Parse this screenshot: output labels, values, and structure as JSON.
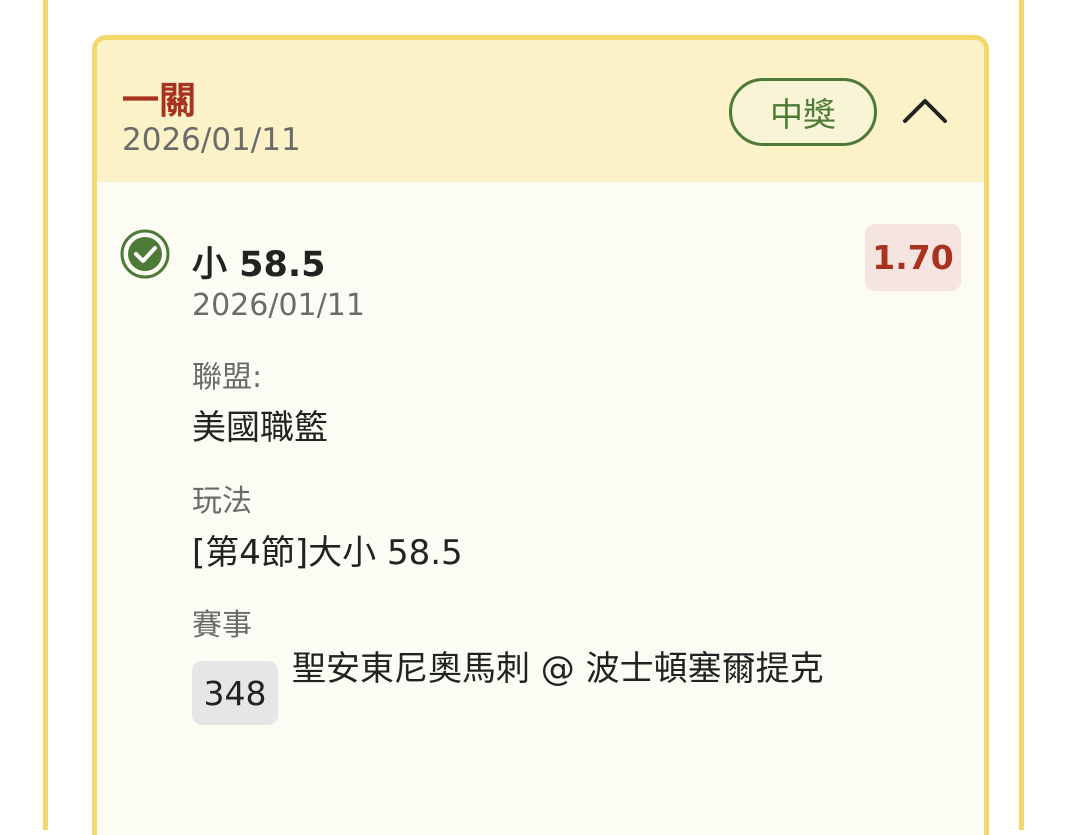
{
  "card": {
    "bet_type": "一關",
    "date": "2026/01/11",
    "status": "中獎",
    "toggle_icon": "chevron-up-icon",
    "colors": {
      "border": "#f3d96a",
      "header_bg": "#fbf2c7",
      "accent_red": "#a8321f",
      "win_green": "#4d7a36"
    }
  },
  "leg": {
    "status_icon": "check-circle-icon",
    "selection": "小 58.5",
    "odds": "1.70",
    "date": "2026/01/11",
    "league_label": "聯盟:",
    "league_value": "美國職籃",
    "market_label": "玩法",
    "market_value": "[第4節]大小 58.5",
    "event_label": "賽事",
    "match_number": "348",
    "match_name": "聖安東尼奧馬刺 @ 波士頓塞爾提克"
  }
}
